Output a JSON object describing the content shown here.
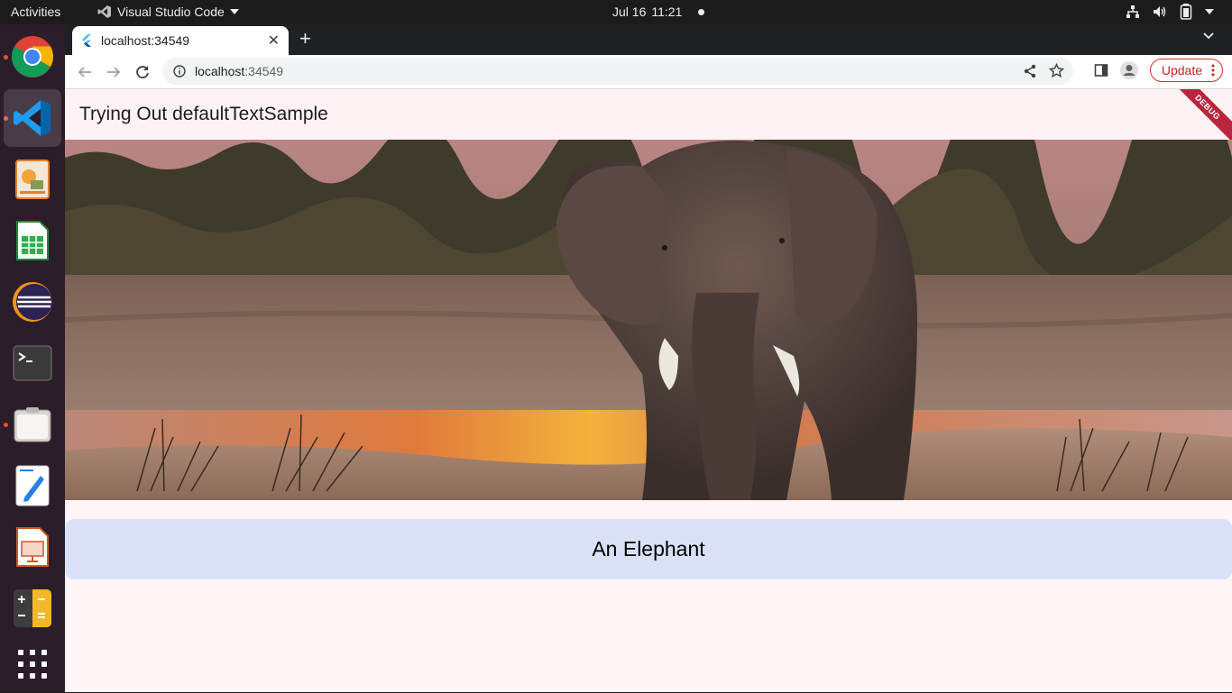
{
  "system_bar": {
    "activities": "Activities",
    "app_name": "Visual Studio Code",
    "date": "Jul 16",
    "time": "11:21"
  },
  "dock": {
    "items": [
      {
        "name": "Google Chrome",
        "icon": "chrome-icon",
        "running": true
      },
      {
        "name": "Visual Studio Code",
        "icon": "vscode-icon",
        "running": true,
        "active": true
      },
      {
        "name": "Image Viewer",
        "icon": "image-viewer-icon"
      },
      {
        "name": "LibreOffice Calc",
        "icon": "calc-icon"
      },
      {
        "name": "Eclipse",
        "icon": "eclipse-icon"
      },
      {
        "name": "Terminal",
        "icon": "terminal-icon"
      },
      {
        "name": "Files",
        "icon": "files-icon",
        "running": true
      },
      {
        "name": "Text Editor",
        "icon": "text-editor-icon"
      },
      {
        "name": "LibreOffice Impress",
        "icon": "impress-icon"
      },
      {
        "name": "Calculator",
        "icon": "calculator-icon"
      },
      {
        "name": "Show Applications",
        "icon": "app-grid-icon"
      }
    ]
  },
  "browser": {
    "tab_title": "localhost:34549",
    "url_host": "localhost",
    "url_port": ":34549",
    "update_label": "Update"
  },
  "app": {
    "appbar_title": "Trying Out defaultTextSample",
    "debug_banner": "DEBUG",
    "caption": "An Elephant"
  },
  "colors": {
    "page_background": "#fff5f7",
    "caption_card": "#d9e1f8",
    "update_accent": "#d93025",
    "dock_background": "#2c1d2a"
  }
}
